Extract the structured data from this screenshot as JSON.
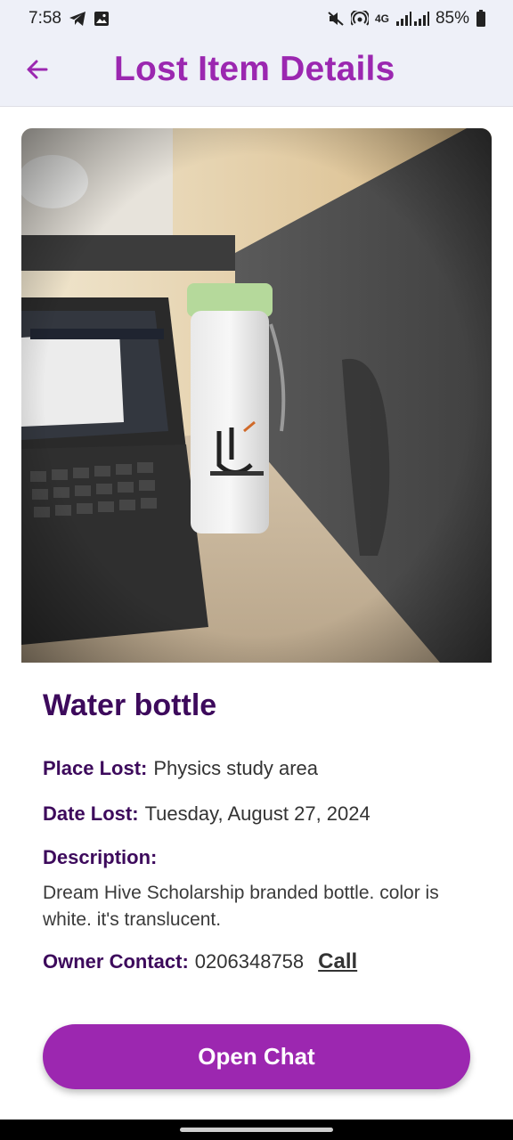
{
  "status_bar": {
    "time": "7:58",
    "network": "4G",
    "battery": "85%",
    "icons": [
      "telegram-icon",
      "gallery-icon",
      "mute-icon",
      "hotspot-icon",
      "signal-icon",
      "battery-icon"
    ]
  },
  "app_bar": {
    "title": "Lost Item Details",
    "back_icon": "arrow-left-icon",
    "accent_color": "#9b27b0"
  },
  "item": {
    "name": "Water bottle",
    "image_subject": "bottle-photo",
    "place_label": "Place Lost:",
    "place_value": "Physics study area",
    "date_label": "Date Lost:",
    "date_value": "Tuesday, August 27, 2024",
    "description_label": "Description:",
    "description_value": "Dream Hive Scholarship branded bottle. color is white. it's translucent.",
    "contact_label": "Owner Contact:",
    "contact_value": "0206348758",
    "call_label": "Call"
  },
  "actions": {
    "open_chat": "Open Chat"
  },
  "colors": {
    "label": "#3d0a5c",
    "button": "#9c27b0"
  }
}
